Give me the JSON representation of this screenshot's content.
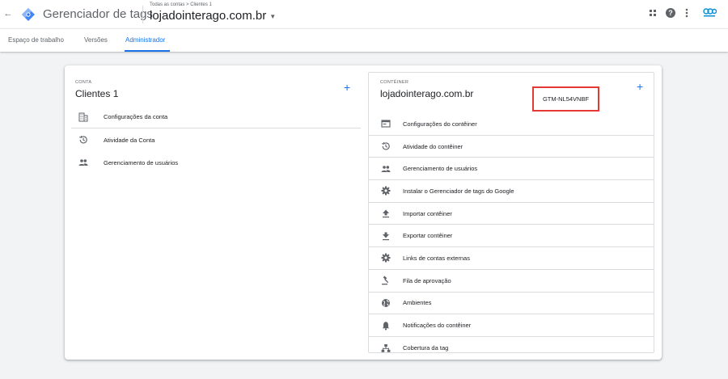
{
  "header": {
    "app_title": "Gerenciador de tags",
    "breadcrumb": "Todas as contas > Clientes 1",
    "account_name": "lojadointerago.com.br",
    "icons": [
      "back-arrow-icon",
      "gtm-logo-icon",
      "apps-grid-icon",
      "help-icon",
      "more-vert-icon",
      "account-avatar-icon"
    ]
  },
  "tabs": [
    {
      "label": "Espaço de trabalho"
    },
    {
      "label": "Versões"
    },
    {
      "label": "Administrador"
    }
  ],
  "account": {
    "label": "CONTA",
    "title": "Clientes 1",
    "items": [
      {
        "label": "Configurações da conta",
        "icon": "building-icon"
      },
      {
        "label": "Atividade da Conta",
        "icon": "history-icon"
      },
      {
        "label": "Gerenciamento de usuários",
        "icon": "people-icon"
      }
    ]
  },
  "container": {
    "label": "CONTÊINER",
    "title": "lojadointerago.com.br",
    "gtm_id": "GTM-NL54VNBF",
    "items": [
      {
        "label": "Configurações do contêiner",
        "icon": "container-settings-icon"
      },
      {
        "label": "Atividade do contêiner",
        "icon": "history-icon"
      },
      {
        "label": "Gerenciamento de usuários",
        "icon": "people-icon"
      },
      {
        "label": "Instalar o Gerenciador de tags do Google",
        "icon": "gear-icon"
      },
      {
        "label": "Importar contêiner",
        "icon": "upload-icon"
      },
      {
        "label": "Exportar contêiner",
        "icon": "download-icon"
      },
      {
        "label": "Links de contas externas",
        "icon": "gear-icon"
      },
      {
        "label": "Fila de aprovação",
        "icon": "gavel-icon"
      },
      {
        "label": "Ambientes",
        "icon": "globe-icon"
      },
      {
        "label": "Notificações do contêiner",
        "icon": "bell-icon"
      },
      {
        "label": "Cobertura da tag",
        "icon": "sitemap-icon"
      }
    ]
  },
  "colors": {
    "accent": "#1a73e8",
    "highlight": "#e53935"
  }
}
